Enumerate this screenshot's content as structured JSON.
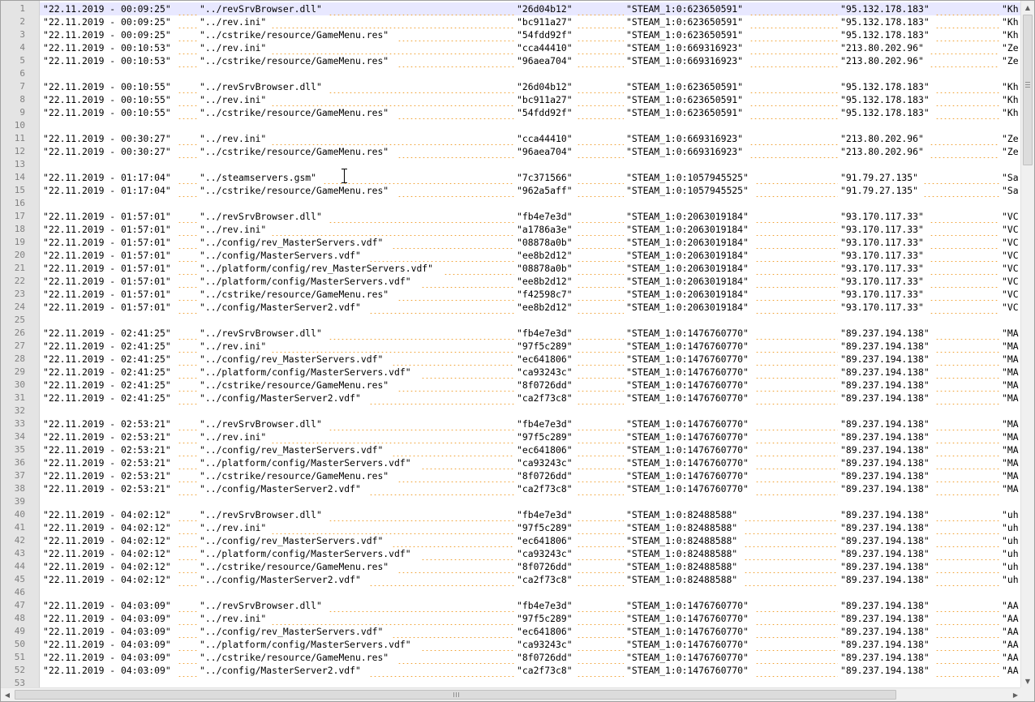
{
  "editor": {
    "line_numbers": [
      "1",
      "2",
      "3",
      "4",
      "5",
      "6",
      "7",
      "8",
      "9",
      "10",
      "11",
      "12",
      "13",
      "14",
      "15",
      "16",
      "17",
      "18",
      "19",
      "20",
      "21",
      "22",
      "23",
      "24",
      "25",
      "26",
      "27",
      "28",
      "29",
      "30",
      "31",
      "32",
      "33",
      "34",
      "35",
      "36",
      "37",
      "38",
      "39",
      "40",
      "41",
      "42",
      "43",
      "44",
      "45",
      "46",
      "47",
      "48",
      "49",
      "50",
      "51",
      "52",
      "53"
    ],
    "lines": [
      [
        "\"22.11.2019 - 00:09:25\"",
        "\"../revSrvBrowser.dll\"",
        "\"26d04b12\"",
        "\"STEAM_1:0:623650591\"",
        "\"95.132.178.183\"",
        "\"Kh"
      ],
      [
        "\"22.11.2019 - 00:09:25\"",
        "\"../rev.ini\"",
        "\"bc911a27\"",
        "\"STEAM_1:0:623650591\"",
        "\"95.132.178.183\"",
        "\"Kh"
      ],
      [
        "\"22.11.2019 - 00:09:25\"",
        "\"../cstrike/resource/GameMenu.res\"",
        "\"54fdd92f\"",
        "\"STEAM_1:0:623650591\"",
        "\"95.132.178.183\"",
        "\"Kh"
      ],
      [
        "\"22.11.2019 - 00:10:53\"",
        "\"../rev.ini\"",
        "\"cca44410\"",
        "\"STEAM_1:0:669316923\"",
        "\"213.80.202.96\"",
        "\"Ze"
      ],
      [
        "\"22.11.2019 - 00:10:53\"",
        "\"../cstrike/resource/GameMenu.res\"",
        "\"96aea704\"",
        "\"STEAM_1:0:669316923\"",
        "\"213.80.202.96\"",
        "\"Ze"
      ],
      [],
      [
        "\"22.11.2019 - 00:10:55\"",
        "\"../revSrvBrowser.dll\"",
        "\"26d04b12\"",
        "\"STEAM_1:0:623650591\"",
        "\"95.132.178.183\"",
        "\"Kh"
      ],
      [
        "\"22.11.2019 - 00:10:55\"",
        "\"../rev.ini\"",
        "\"bc911a27\"",
        "\"STEAM_1:0:623650591\"",
        "\"95.132.178.183\"",
        "\"Kh"
      ],
      [
        "\"22.11.2019 - 00:10:55\"",
        "\"../cstrike/resource/GameMenu.res\"",
        "\"54fdd92f\"",
        "\"STEAM_1:0:623650591\"",
        "\"95.132.178.183\"",
        "\"Kh"
      ],
      [],
      [
        "\"22.11.2019 - 00:30:27\"",
        "\"../rev.ini\"",
        "\"cca44410\"",
        "\"STEAM_1:0:669316923\"",
        "\"213.80.202.96\"",
        "\"Ze"
      ],
      [
        "\"22.11.2019 - 00:30:27\"",
        "\"../cstrike/resource/GameMenu.res\"",
        "\"96aea704\"",
        "\"STEAM_1:0:669316923\"",
        "\"213.80.202.96\"",
        "\"Ze"
      ],
      [],
      [
        "\"22.11.2019 - 01:17:04\"",
        "\"../steamservers.gsm\"",
        "\"7c371566\"",
        "\"STEAM_1:0:1057945525\"",
        "\"91.79.27.135\"",
        "\"Sa"
      ],
      [
        "\"22.11.2019 - 01:17:04\"",
        "\"../cstrike/resource/GameMenu.res\"",
        "\"962a5aff\"",
        "\"STEAM_1:0:1057945525\"",
        "\"91.79.27.135\"",
        "\"Sa"
      ],
      [],
      [
        "\"22.11.2019 - 01:57:01\"",
        "\"../revSrvBrowser.dll\"",
        "\"fb4e7e3d\"",
        "\"STEAM_1:0:2063019184\"",
        "\"93.170.117.33\"",
        "\"VC"
      ],
      [
        "\"22.11.2019 - 01:57:01\"",
        "\"../rev.ini\"",
        "\"a1786a3e\"",
        "\"STEAM_1:0:2063019184\"",
        "\"93.170.117.33\"",
        "\"VC"
      ],
      [
        "\"22.11.2019 - 01:57:01\"",
        "\"../config/rev_MasterServers.vdf\"",
        "\"08878a0b\"",
        "\"STEAM_1:0:2063019184\"",
        "\"93.170.117.33\"",
        "\"VC"
      ],
      [
        "\"22.11.2019 - 01:57:01\"",
        "\"../config/MasterServers.vdf\"",
        "\"ee8b2d12\"",
        "\"STEAM_1:0:2063019184\"",
        "\"93.170.117.33\"",
        "\"VC"
      ],
      [
        "\"22.11.2019 - 01:57:01\"",
        "\"../platform/config/rev_MasterServers.vdf\"",
        "\"08878a0b\"",
        "\"STEAM_1:0:2063019184\"",
        "\"93.170.117.33\"",
        "\"VC"
      ],
      [
        "\"22.11.2019 - 01:57:01\"",
        "\"../platform/config/MasterServers.vdf\"",
        "\"ee8b2d12\"",
        "\"STEAM_1:0:2063019184\"",
        "\"93.170.117.33\"",
        "\"VC"
      ],
      [
        "\"22.11.2019 - 01:57:01\"",
        "\"../cstrike/resource/GameMenu.res\"",
        "\"f42598c7\"",
        "\"STEAM_1:0:2063019184\"",
        "\"93.170.117.33\"",
        "\"VC"
      ],
      [
        "\"22.11.2019 - 01:57:01\"",
        "\"../config/MasterServer2.vdf\"",
        "\"ee8b2d12\"",
        "\"STEAM_1:0:2063019184\"",
        "\"93.170.117.33\"",
        "\"VC"
      ],
      [],
      [
        "\"22.11.2019 - 02:41:25\"",
        "\"../revSrvBrowser.dll\"",
        "\"fb4e7e3d\"",
        "\"STEAM_1:0:1476760770\"",
        "\"89.237.194.138\"",
        "\"MA"
      ],
      [
        "\"22.11.2019 - 02:41:25\"",
        "\"../rev.ini\"",
        "\"97f5c289\"",
        "\"STEAM_1:0:1476760770\"",
        "\"89.237.194.138\"",
        "\"MA"
      ],
      [
        "\"22.11.2019 - 02:41:25\"",
        "\"../config/rev_MasterServers.vdf\"",
        "\"ec641806\"",
        "\"STEAM_1:0:1476760770\"",
        "\"89.237.194.138\"",
        "\"MA"
      ],
      [
        "\"22.11.2019 - 02:41:25\"",
        "\"../platform/config/MasterServers.vdf\"",
        "\"ca93243c\"",
        "\"STEAM_1:0:1476760770\"",
        "\"89.237.194.138\"",
        "\"MA"
      ],
      [
        "\"22.11.2019 - 02:41:25\"",
        "\"../cstrike/resource/GameMenu.res\"",
        "\"8f0726dd\"",
        "\"STEAM_1:0:1476760770\"",
        "\"89.237.194.138\"",
        "\"MA"
      ],
      [
        "\"22.11.2019 - 02:41:25\"",
        "\"../config/MasterServer2.vdf\"",
        "\"ca2f73c8\"",
        "\"STEAM_1:0:1476760770\"",
        "\"89.237.194.138\"",
        "\"MA"
      ],
      [],
      [
        "\"22.11.2019 - 02:53:21\"",
        "\"../revSrvBrowser.dll\"",
        "\"fb4e7e3d\"",
        "\"STEAM_1:0:1476760770\"",
        "\"89.237.194.138\"",
        "\"MA"
      ],
      [
        "\"22.11.2019 - 02:53:21\"",
        "\"../rev.ini\"",
        "\"97f5c289\"",
        "\"STEAM_1:0:1476760770\"",
        "\"89.237.194.138\"",
        "\"MA"
      ],
      [
        "\"22.11.2019 - 02:53:21\"",
        "\"../config/rev_MasterServers.vdf\"",
        "\"ec641806\"",
        "\"STEAM_1:0:1476760770\"",
        "\"89.237.194.138\"",
        "\"MA"
      ],
      [
        "\"22.11.2019 - 02:53:21\"",
        "\"../platform/config/MasterServers.vdf\"",
        "\"ca93243c\"",
        "\"STEAM_1:0:1476760770\"",
        "\"89.237.194.138\"",
        "\"MA"
      ],
      [
        "\"22.11.2019 - 02:53:21\"",
        "\"../cstrike/resource/GameMenu.res\"",
        "\"8f0726dd\"",
        "\"STEAM_1:0:1476760770\"",
        "\"89.237.194.138\"",
        "\"MA"
      ],
      [
        "\"22.11.2019 - 02:53:21\"",
        "\"../config/MasterServer2.vdf\"",
        "\"ca2f73c8\"",
        "\"STEAM_1:0:1476760770\"",
        "\"89.237.194.138\"",
        "\"MA"
      ],
      [],
      [
        "\"22.11.2019 - 04:02:12\"",
        "\"../revSrvBrowser.dll\"",
        "\"fb4e7e3d\"",
        "\"STEAM_1:0:82488588\"",
        "\"89.237.194.138\"",
        "\"uh"
      ],
      [
        "\"22.11.2019 - 04:02:12\"",
        "\"../rev.ini\"",
        "\"97f5c289\"",
        "\"STEAM_1:0:82488588\"",
        "\"89.237.194.138\"",
        "\"uh"
      ],
      [
        "\"22.11.2019 - 04:02:12\"",
        "\"../config/rev_MasterServers.vdf\"",
        "\"ec641806\"",
        "\"STEAM_1:0:82488588\"",
        "\"89.237.194.138\"",
        "\"uh"
      ],
      [
        "\"22.11.2019 - 04:02:12\"",
        "\"../platform/config/MasterServers.vdf\"",
        "\"ca93243c\"",
        "\"STEAM_1:0:82488588\"",
        "\"89.237.194.138\"",
        "\"uh"
      ],
      [
        "\"22.11.2019 - 04:02:12\"",
        "\"../cstrike/resource/GameMenu.res\"",
        "\"8f0726dd\"",
        "\"STEAM_1:0:82488588\"",
        "\"89.237.194.138\"",
        "\"uh"
      ],
      [
        "\"22.11.2019 - 04:02:12\"",
        "\"../config/MasterServer2.vdf\"",
        "\"ca2f73c8\"",
        "\"STEAM_1:0:82488588\"",
        "\"89.237.194.138\"",
        "\"uh"
      ],
      [],
      [
        "\"22.11.2019 - 04:03:09\"",
        "\"../revSrvBrowser.dll\"",
        "\"fb4e7e3d\"",
        "\"STEAM_1:0:1476760770\"",
        "\"89.237.194.138\"",
        "\"AA"
      ],
      [
        "\"22.11.2019 - 04:03:09\"",
        "\"../rev.ini\"",
        "\"97f5c289\"",
        "\"STEAM_1:0:1476760770\"",
        "\"89.237.194.138\"",
        "\"AA"
      ],
      [
        "\"22.11.2019 - 04:03:09\"",
        "\"../config/rev_MasterServers.vdf\"",
        "\"ec641806\"",
        "\"STEAM_1:0:1476760770\"",
        "\"89.237.194.138\"",
        "\"AA"
      ],
      [
        "\"22.11.2019 - 04:03:09\"",
        "\"../platform/config/MasterServers.vdf\"",
        "\"ca93243c\"",
        "\"STEAM_1:0:1476760770\"",
        "\"89.237.194.138\"",
        "\"AA"
      ],
      [
        "\"22.11.2019 - 04:03:09\"",
        "\"../cstrike/resource/GameMenu.res\"",
        "\"8f0726dd\"",
        "\"STEAM_1:0:1476760770\"",
        "\"89.237.194.138\"",
        "\"AA"
      ],
      [
        "\"22.11.2019 - 04:03:09\"",
        "\"../config/MasterServer2.vdf\"",
        "\"ca2f73c8\"",
        "\"STEAM_1:0:1476760770\"",
        "\"89.237.194.138\"",
        "\"AA"
      ],
      []
    ]
  },
  "scrollbars": {
    "vertical_up_glyph": "▲",
    "vertical_down_glyph": "▼",
    "horizontal_left_glyph": "◀",
    "horizontal_right_glyph": "▶"
  },
  "theme": {
    "gutter_bg": "#e4e4e4",
    "current_line_bg": "#e8e8ff",
    "whitespace_dot_color": "#f0a030",
    "line_number_color": "#808080"
  }
}
